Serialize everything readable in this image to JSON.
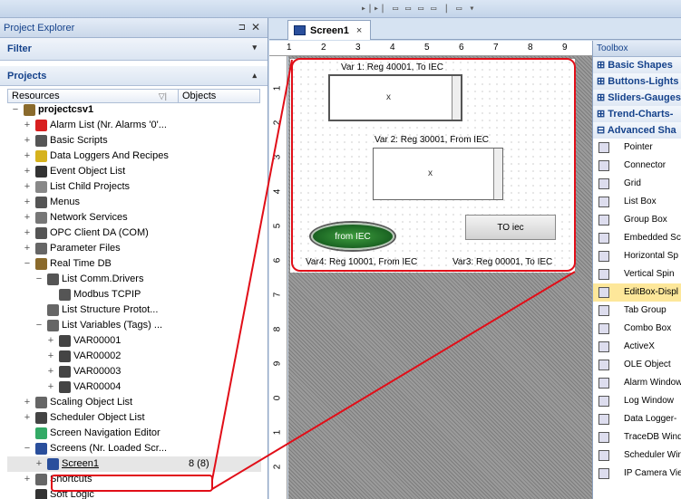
{
  "explorer": {
    "title": "Project Explorer",
    "pin": "⌥",
    "close": "✕",
    "filter": "Filter",
    "projects": "Projects",
    "col_resources": "Resources",
    "col_objects": "Objects",
    "tree": [
      {
        "label": "projectcsv1",
        "exp": "−",
        "indent": 0,
        "bold": true,
        "icon": "#8a6a2c"
      },
      {
        "label": "Alarm List (Nr. Alarms '0'...",
        "exp": "+",
        "indent": 1,
        "icon": "#d81f1f"
      },
      {
        "label": "Basic Scripts",
        "exp": "+",
        "indent": 1,
        "icon": "#555"
      },
      {
        "label": "Data Loggers And Recipes",
        "exp": "+",
        "indent": 1,
        "icon": "#d6b21d"
      },
      {
        "label": "Event Object List",
        "exp": "+",
        "indent": 1,
        "icon": "#333"
      },
      {
        "label": "List Child Projects",
        "exp": "+",
        "indent": 1,
        "icon": "#888"
      },
      {
        "label": "Menus",
        "exp": "+",
        "indent": 1,
        "icon": "#555"
      },
      {
        "label": "Network Services",
        "exp": "+",
        "indent": 1,
        "icon": "#777"
      },
      {
        "label": "OPC Client DA (COM)",
        "exp": "+",
        "indent": 1,
        "icon": "#555"
      },
      {
        "label": "Parameter Files",
        "exp": "+",
        "indent": 1,
        "icon": "#666"
      },
      {
        "label": "Real Time DB",
        "exp": "−",
        "indent": 1,
        "icon": "#8a6a2c"
      },
      {
        "label": "List Comm.Drivers",
        "exp": "−",
        "indent": 2,
        "icon": "#555"
      },
      {
        "label": "Modbus TCPIP",
        "exp": "",
        "indent": 3,
        "icon": "#555"
      },
      {
        "label": "List Structure Protot...",
        "exp": "",
        "indent": 2,
        "icon": "#666"
      },
      {
        "label": "List Variables (Tags) ...",
        "exp": "−",
        "indent": 2,
        "icon": "#666"
      },
      {
        "label": "VAR00001",
        "exp": "+",
        "indent": 3,
        "icon": "#444"
      },
      {
        "label": "VAR00002",
        "exp": "+",
        "indent": 3,
        "icon": "#444"
      },
      {
        "label": "VAR00003",
        "exp": "+",
        "indent": 3,
        "icon": "#444"
      },
      {
        "label": "VAR00004",
        "exp": "+",
        "indent": 3,
        "icon": "#444"
      },
      {
        "label": "Scaling Object List",
        "exp": "+",
        "indent": 1,
        "icon": "#666"
      },
      {
        "label": "Scheduler Object List",
        "exp": "+",
        "indent": 1,
        "icon": "#444"
      },
      {
        "label": "Screen Navigation Editor",
        "exp": "",
        "indent": 1,
        "icon": "#3a6"
      },
      {
        "label": "Screens (Nr. Loaded Scr...",
        "exp": "−",
        "indent": 1,
        "icon": "#2a4f9c"
      },
      {
        "label": "Screen1",
        "exp": "+",
        "indent": 2,
        "icon": "#2a4f9c",
        "objects": "8 (8)",
        "selected": true,
        "underline": true
      },
      {
        "label": "Shortcuts",
        "exp": "+",
        "indent": 1,
        "icon": "#666"
      },
      {
        "label": "Soft Logic",
        "exp": "",
        "indent": 1,
        "icon": "#333"
      }
    ]
  },
  "tab": {
    "label": "Screen1",
    "close": "×"
  },
  "canvas": {
    "var1": "Var 1: Reg 40001, To IEC",
    "var2": "Var 2: Reg 30001, From IEC",
    "var3": "Var3: Reg 00001, To IEC",
    "var4": "Var4: Reg 10001, From IEC",
    "oval_label": "from IEC",
    "button_label": "TO iec",
    "x": "x"
  },
  "ruler": {
    "h": [
      "1",
      "2",
      "3",
      "4",
      "5",
      "6",
      "7",
      "8",
      "9"
    ],
    "v": [
      "1",
      "2",
      "3",
      "4",
      "5",
      "6",
      "7",
      "8",
      "9",
      "0",
      "1",
      "2"
    ]
  },
  "toolbox": {
    "title": "Toolbox",
    "categories": [
      "⊞ Basic Shapes",
      "⊞ Buttons-Lights",
      "⊞ Sliders-Gauges",
      "⊞ Trend-Charts-",
      "⊟ Advanced Sha"
    ],
    "items": [
      "Pointer",
      "Connector",
      "Grid",
      "List Box",
      "Group Box",
      "Embedded Sc",
      "Horizontal Sp",
      "Vertical Spin",
      "EditBox-Displ",
      "Tab Group",
      "Combo Box",
      "ActiveX",
      "OLE Object",
      "Alarm Window",
      "Log Window",
      "Data Logger-",
      "TraceDB Wind",
      "Scheduler Win",
      "IP Camera Vie"
    ],
    "highlight_index": 8
  }
}
